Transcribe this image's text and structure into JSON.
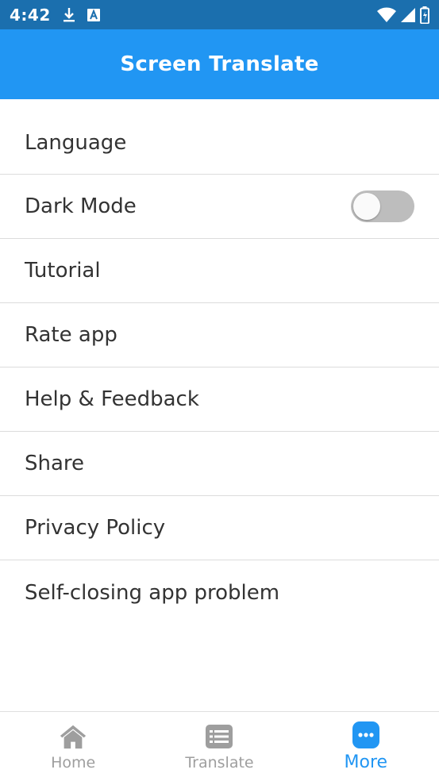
{
  "status_bar": {
    "time": "4:42",
    "icons": [
      "download-icon",
      "a-badge-icon",
      "wifi-icon",
      "signal-icon",
      "battery-icon"
    ]
  },
  "app_bar": {
    "title": "Screen Translate"
  },
  "menu": {
    "items": [
      {
        "label": "Language"
      },
      {
        "label": "Dark Mode",
        "toggle": false
      },
      {
        "label": "Tutorial"
      },
      {
        "label": "Rate app"
      },
      {
        "label": "Help & Feedback"
      },
      {
        "label": "Share"
      },
      {
        "label": "Privacy Policy"
      },
      {
        "label": "Self-closing app problem"
      }
    ]
  },
  "bottom_nav": {
    "items": [
      {
        "label": "Home",
        "icon": "home-icon"
      },
      {
        "label": "Translate",
        "icon": "translate-list-icon"
      },
      {
        "label": "More",
        "icon": "more-icon",
        "active": true
      }
    ]
  },
  "colors": {
    "status_bar": "#1b6fae",
    "app_bar": "#2196f3",
    "accent": "#2196f3",
    "inactive": "#9e9e9e",
    "toggle_off": "#bdbdbd"
  }
}
